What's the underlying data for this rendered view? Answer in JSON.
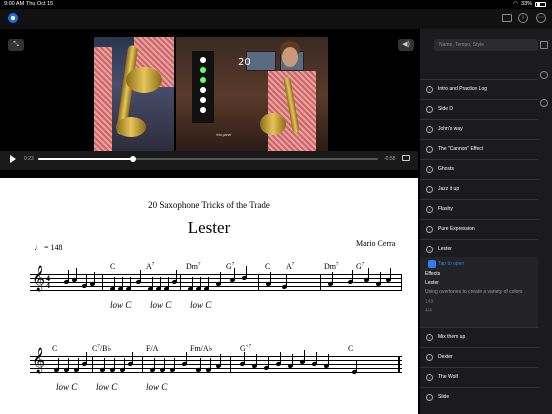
{
  "status_bar": {
    "time": "9:00 AM",
    "date": "Thu Oct 15",
    "battery": "33%"
  },
  "toolbar": {
    "app_icon": "app-icon"
  },
  "video": {
    "current_time": "0:23",
    "remaining_time": "-0:58",
    "progress": 0.28,
    "panel_label": "info panel",
    "panel_number": "20"
  },
  "score": {
    "book_title": "20 Saxophone Tricks of the Trade",
    "song_title": "Lester",
    "tempo": "= 148",
    "composer": "Mario Cerra",
    "row1_chords": [
      "C",
      "A7",
      "Dm7",
      "G7",
      "C",
      "A7",
      "Dm7",
      "G7"
    ],
    "row2_chords": [
      "C",
      "C7/B♭",
      "F/A",
      "Fm/A♭",
      "G+7",
      "C"
    ],
    "low_c": "low C"
  },
  "sidebar": {
    "search_placeholder": "Name, Tempo, Style",
    "items": [
      {
        "label": "Intro and Practice Log"
      },
      {
        "label": "Side D"
      },
      {
        "label": "John's way"
      },
      {
        "label": "The \"Cannon\" Effect"
      },
      {
        "label": "Ghosts"
      },
      {
        "label": "Jazz it up"
      },
      {
        "label": "Flashy"
      },
      {
        "label": "Pure Expression"
      },
      {
        "label": "Lester"
      },
      {
        "label": "Mix them up"
      },
      {
        "label": "Dexter"
      },
      {
        "label": "The Wolf"
      },
      {
        "label": "Slide"
      }
    ],
    "expanded": {
      "tap_to_open": "Tap to open",
      "section_title": "Effects",
      "item_title": "Lester",
      "description": "Using overtones to create a variety of colors",
      "meta1": "148",
      "meta2": "4/4"
    }
  },
  "colors": {
    "accent": "#2f7df6",
    "sidebar_bg": "#1b1b1d"
  }
}
